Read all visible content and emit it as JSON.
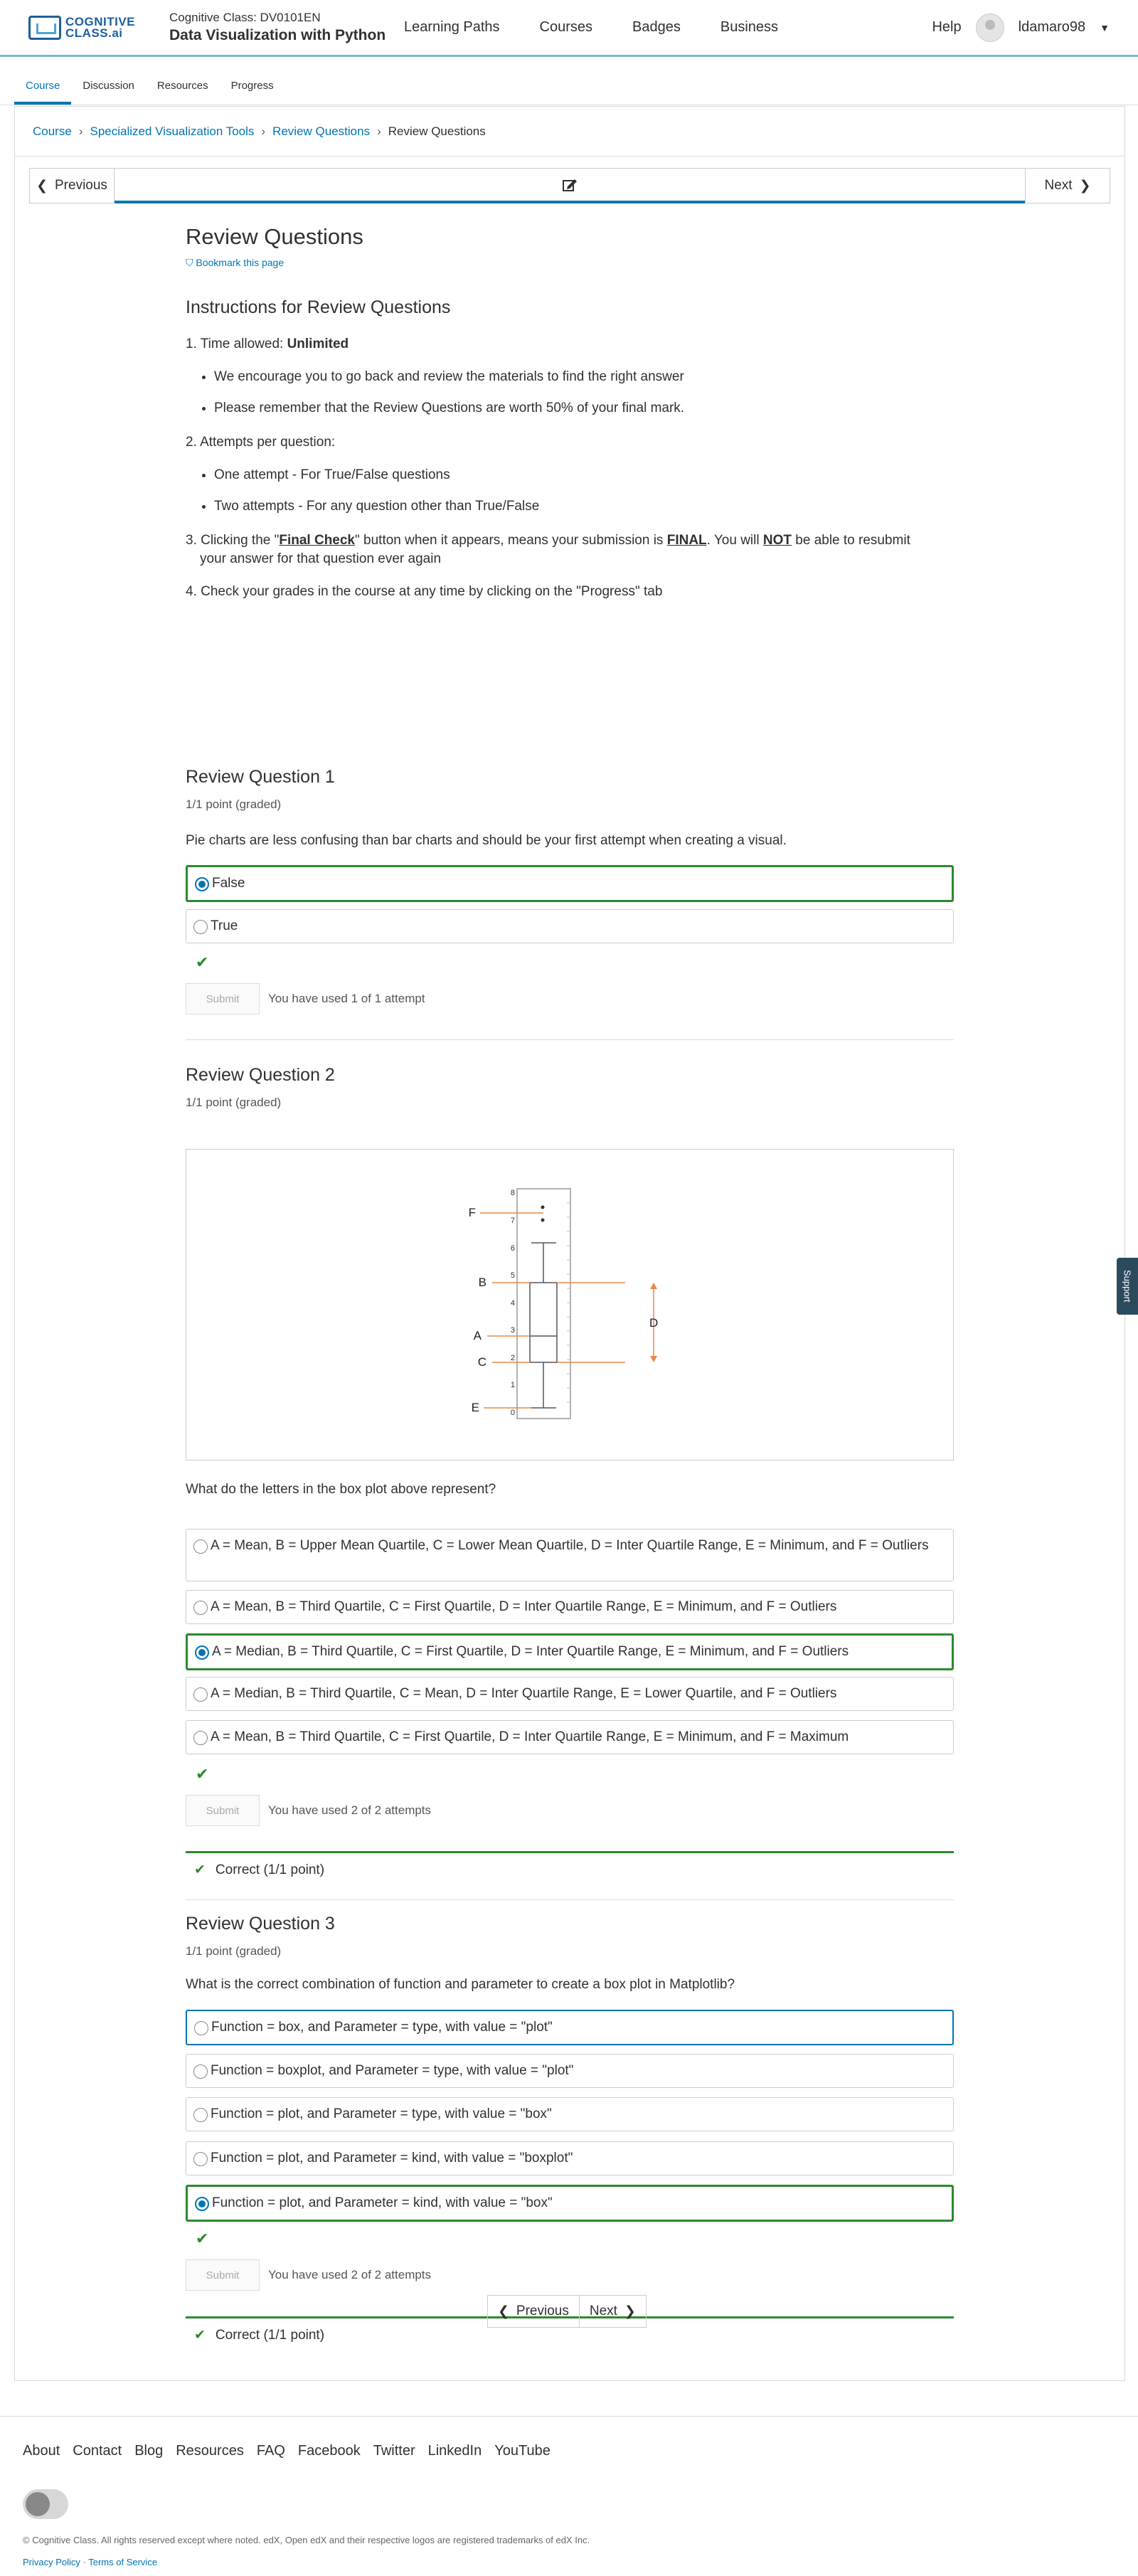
{
  "header": {
    "logo_text_1": "COGNITIVE",
    "logo_text_2": "CLASS.ai",
    "course_code": "Cognitive Class: DV0101EN",
    "course_name": "Data Visualization with Python",
    "nav": [
      "Learning Paths",
      "Courses",
      "Badges",
      "Business"
    ],
    "help": "Help",
    "username": "ldamaro98"
  },
  "tabs": [
    "Course",
    "Discussion",
    "Resources",
    "Progress"
  ],
  "breadcrumbs": [
    "Course",
    "Specialized Visualization Tools",
    "Review Questions",
    "Review Questions"
  ],
  "sequence": {
    "previous": "Previous",
    "next": "Next"
  },
  "page": {
    "title": "Review Questions",
    "bookmark": "Bookmark this page",
    "instructions_title": "Instructions for Review Questions",
    "item1_prefix": "1. Time allowed: ",
    "item1_bold": "Unlimited",
    "item1_bullets": [
      "We encourage you to go back and review the materials to find the right answer",
      "Please remember that the Review Questions are worth 50% of your final mark."
    ],
    "item2": "2. Attempts per question:",
    "item2_bullets": [
      "One attempt - For True/False questions",
      "Two attempts - For any question other than True/False"
    ],
    "item3_a": "3. Clicking the \"",
    "item3_b": "Final Check",
    "item3_c": "\" button when it appears, means your submission is ",
    "item3_d": "FINAL",
    "item3_e": ".  You will ",
    "item3_f": "NOT",
    "item3_g": " be able to resubmit your answer for that question ever again",
    "item4": "4. Check your grades in the course at any time by clicking on the \"Progress\" tab"
  },
  "q1": {
    "title": "Review Question 1",
    "points": "1/1 point (graded)",
    "text": "Pie charts are less confusing than bar charts and should be your first attempt when creating a visual.",
    "options": [
      "False",
      "True"
    ],
    "submit": "Submit",
    "attempts": "You have used 1 of 1 attempt"
  },
  "q2": {
    "title": "Review Question 2",
    "points": "1/1 point (graded)",
    "figure_letters": [
      "F",
      "B",
      "A",
      "C",
      "E",
      "D"
    ],
    "figure_ticks": [
      "8",
      "7",
      "6",
      "5",
      "4",
      "3",
      "2",
      "1",
      "0"
    ],
    "text": "What do the letters in the box plot above represent?",
    "options": [
      "A = Mean, B = Upper Mean Quartile, C = Lower Mean Quartile, D = Inter Quartile Range, E = Minimum, and F = Outliers",
      "A = Mean, B = Third Quartile, C = First Quartile, D = Inter Quartile Range, E = Minimum, and F = Outliers",
      "A = Median, B = Third Quartile, C = First Quartile, D = Inter Quartile Range, E = Minimum, and F = Outliers",
      "A = Median, B = Third Quartile, C = Mean, D = Inter Quartile Range, E = Lower Quartile, and F = Outliers",
      "A = Mean, B = Third Quartile, C = First Quartile, D = Inter Quartile Range, E = Minimum, and F = Maximum"
    ],
    "submit": "Submit",
    "attempts": "You have used 2 of 2 attempts",
    "result": "Correct (1/1 point)"
  },
  "q3": {
    "title": "Review Question 3",
    "points": "1/1 point (graded)",
    "text": "What is the correct combination of function and parameter to create a box plot in Matplotlib?",
    "options": [
      "Function = box, and Parameter = type, with value = \"plot\"",
      "Function = boxplot, and Parameter = type, with value = \"plot\"",
      "Function = plot, and Parameter = type, with value = \"box\"",
      "Function = plot, and Parameter = kind, with value = \"boxplot\"",
      "Function = plot, and Parameter = kind, with value = \"box\""
    ],
    "submit": "Submit",
    "attempts": "You have used 2 of 2 attempts",
    "result": "Correct (1/1 point)"
  },
  "support": "Support",
  "footer": {
    "links": [
      "About",
      "Contact",
      "Blog",
      "Resources",
      "FAQ",
      "Facebook",
      "Twitter",
      "LinkedIn",
      "YouTube"
    ],
    "copyright": "© Cognitive Class. All rights reserved except where noted. edX, Open edX and their respective logos are registered trademarks of edX Inc.",
    "privacy": "Privacy Policy",
    "sep": " · ",
    "terms": "Terms of Service"
  },
  "colors": {
    "accent": "#0075b4",
    "correct": "#2b8a2b",
    "figure_lines": "#e8884a"
  }
}
